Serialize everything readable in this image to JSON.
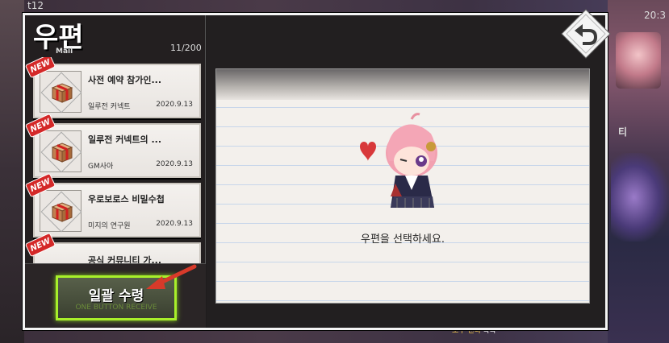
{
  "background": {
    "status_left": "t12",
    "status_right": "20:3",
    "side_text": "티",
    "bottom_notice_prefix": "",
    "bottom_notice_highlight": "오우 젠타",
    "bottom_notice_suffix": "획득"
  },
  "mailbox": {
    "title": "우편",
    "subtitle": "Mail",
    "count": "11/200",
    "items": [
      {
        "badge": "NEW",
        "name": "사전 예약 참가인...",
        "sender": "일루전 커넥트",
        "date": "2020.9.13"
      },
      {
        "badge": "NEW",
        "name": "일루전 커넥트의 ...",
        "sender": "GM사아",
        "date": "2020.9.13"
      },
      {
        "badge": "NEW",
        "name": "우로보로스 비밀수첩",
        "sender": "미지의 연구원",
        "date": "2020.9.13"
      },
      {
        "badge": "NEW",
        "name": "공식 커뮤니티 가...",
        "sender": "",
        "date": ""
      }
    ],
    "bulk_button": {
      "label": "일괄 수령",
      "sub": "ONE BUTTON RECEIVE"
    },
    "empty_prompt": "우편을 선택하세요."
  },
  "colors": {
    "accent_green": "#a8f02a",
    "new_badge": "#d42828"
  },
  "icons": [
    "back-arrow-icon",
    "gift-box-icon",
    "pointer-arrow-icon"
  ]
}
